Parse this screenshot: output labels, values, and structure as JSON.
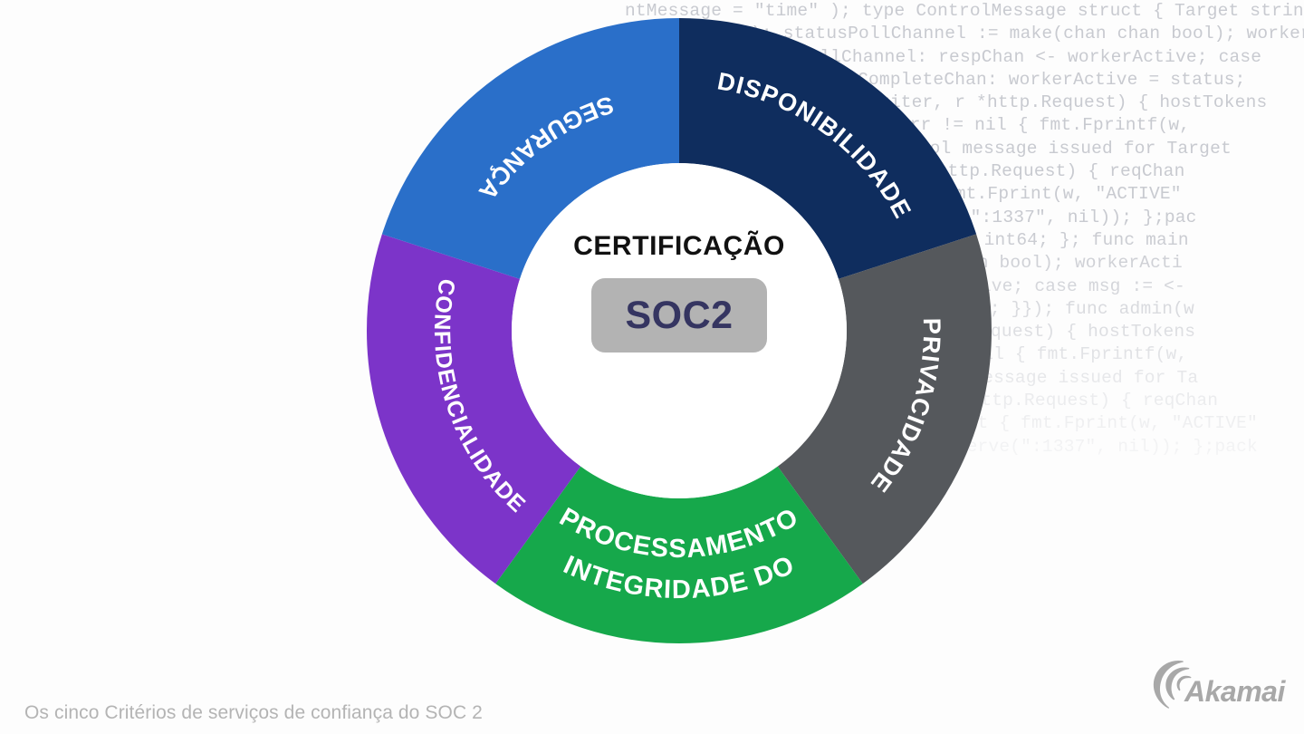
{
  "caption": "Os cinco Critérios de serviços de confiança do SOC 2",
  "center": {
    "title": "CERTIFICAÇÃO",
    "badge_label": "SOC2",
    "badge_bg": "#b3b3b3",
    "badge_text_color": "#353561"
  },
  "brand": {
    "name": "Akamai",
    "logo_color": "#a8a8a8"
  },
  "background_code": {
    "font": "monospace",
    "color": "#c8cad0",
    "lines": [
      "ntMessage = \"time\" ); type ControlMessage struct { Target string; Count",
      "(chan bool); statusPollChannel := make(chan chan bool); workerActive",
      "statusPollChannel: respChan <- workerActive; case",
      "<- workerCompleteChan: workerActive = status;",
      "p.ResponseWriter, r *http.Request) { hostTokens",
      "nt, 64); if err != nil { fmt.Fprintf(w,",
      "intf(w, \"Control message issued for Target",
      "seWriter, r *http.Request) { reqChan",
      "if result { fmt.Fprint(w, \"ACTIVE\"",
      "istenAndServe(\":1337\", nil)); };pac",
      "string; Count int64; }; func main",
      "make(chan chan bool); workerActi",
      "<- workerActive; case msg := <-",
      "ive = status; }}); func admin(w",
      "r *http.Request) { hostTokens",
      "err != nil { fmt.Fprintf(w,",
      "ontrol message issued for Ta",
      "r, r *http.Request) { reqChan",
      "result { fmt.Fprint(w, \"ACTIVE\"",
      "AndServe(\":1337\", nil)); };pack"
    ]
  },
  "chart_data": {
    "type": "pie",
    "title": "CERTIFICAÇÃO SOC2",
    "subtitle": "Os cinco Critérios de serviços de confiança do SOC 2",
    "donut": true,
    "inner_radius_ratio": 0.535,
    "legend": "labels-on-slices",
    "categories": [
      "DISPONIBILIDADE",
      "PRIVACIDADE",
      "INTEGRIDADE DO PROCESSAMENTO",
      "CONFIDENCIALIDADE",
      "SEGURANÇA"
    ],
    "values": [
      20,
      20,
      20,
      20,
      20
    ],
    "colors": [
      "#0f2d5e",
      "#55585c",
      "#16a84b",
      "#7c34c9",
      "#2a6fc9"
    ],
    "slices": [
      {
        "label": "DISPONIBILIDADE",
        "value": 20,
        "color": "#0f2d5e",
        "start_angle": 0,
        "end_angle": 72,
        "label_lines": [
          "DISPONIBILIDADE"
        ]
      },
      {
        "label": "PRIVACIDADE",
        "value": 20,
        "color": "#55585c",
        "start_angle": 72,
        "end_angle": 144,
        "label_lines": [
          "PRIVACIDADE"
        ]
      },
      {
        "label": "INTEGRIDADE DO PROCESSAMENTO",
        "value": 20,
        "color": "#16a84b",
        "start_angle": 144,
        "end_angle": 216,
        "label_lines": [
          "INTEGRIDADE DO",
          "PROCESSAMENTO"
        ]
      },
      {
        "label": "CONFIDENCIALIDADE",
        "value": 20,
        "color": "#7c34c9",
        "start_angle": 216,
        "end_angle": 288,
        "label_lines": [
          "CONFIDENCIALIDADE"
        ]
      },
      {
        "label": "SEGURANÇA",
        "value": 20,
        "color": "#2a6fc9",
        "start_angle": 288,
        "end_angle": 360,
        "label_lines": [
          "SEGURANÇA"
        ]
      }
    ]
  }
}
